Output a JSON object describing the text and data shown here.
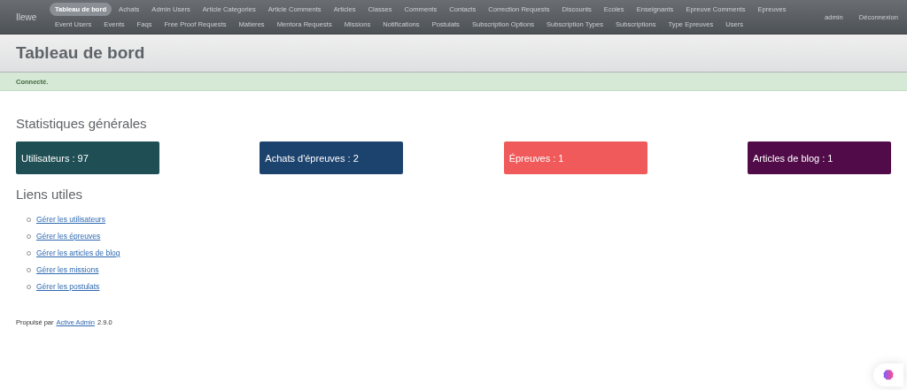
{
  "header": {
    "site_title": "Ilewe",
    "nav_rows": [
      {
        "items": [
          {
            "label": "Tableau de bord",
            "selected": true
          },
          {
            "label": "Achats",
            "selected": false
          },
          {
            "label": "Admin Users",
            "selected": false
          },
          {
            "label": "Article Categories",
            "selected": false
          },
          {
            "label": "Article Comments",
            "selected": false
          },
          {
            "label": "Articles",
            "selected": false
          },
          {
            "label": "Classes",
            "selected": false
          },
          {
            "label": "Comments",
            "selected": false
          },
          {
            "label": "Contacts",
            "selected": false
          },
          {
            "label": "Correction Requests",
            "selected": false
          },
          {
            "label": "Discounts",
            "selected": false
          },
          {
            "label": "Ecoles",
            "selected": false
          },
          {
            "label": "Enseignants",
            "selected": false
          },
          {
            "label": "Epreuve Comments",
            "selected": false
          },
          {
            "label": "Epreuves",
            "selected": false
          }
        ]
      },
      {
        "items": [
          {
            "label": "Event Users",
            "selected": false
          },
          {
            "label": "Events",
            "selected": false
          },
          {
            "label": "Faqs",
            "selected": false
          },
          {
            "label": "Free Proof Requests",
            "selected": false
          },
          {
            "label": "Matieres",
            "selected": false
          },
          {
            "label": "Mentora Requests",
            "selected": false
          },
          {
            "label": "Missions",
            "selected": false
          },
          {
            "label": "Notifications",
            "selected": false
          },
          {
            "label": "Postulats",
            "selected": false
          },
          {
            "label": "Subscription Options",
            "selected": false
          },
          {
            "label": "Subscription Types",
            "selected": false
          },
          {
            "label": "Subscriptions",
            "selected": false
          },
          {
            "label": "Type Epreuves",
            "selected": false
          },
          {
            "label": "Users",
            "selected": false
          }
        ]
      }
    ],
    "utility": [
      "admin",
      "Déconnexion"
    ]
  },
  "page_title": "Tableau de bord",
  "flash": "Connecté.",
  "stats_title": "Statistiques générales",
  "stats": [
    {
      "label": "Utilisateurs : 97",
      "color": "#1f4f55"
    },
    {
      "label": "Achats d'épreuves : 2",
      "color": "#1c426e"
    },
    {
      "label": "Épreuves : 1",
      "color": "#f05a5a"
    },
    {
      "label": "Articles de blog : 1",
      "color": "#500b48"
    }
  ],
  "links_title": "Liens utiles",
  "links": [
    "Gérer les utilisateurs",
    "Gérer les épreuves",
    "Gérer les articles de blog",
    "Gérer les missions",
    "Gérer les postulats"
  ],
  "footer": {
    "prefix": "Propulsé par",
    "link": "Active Admin",
    "version": "2.9.0"
  }
}
